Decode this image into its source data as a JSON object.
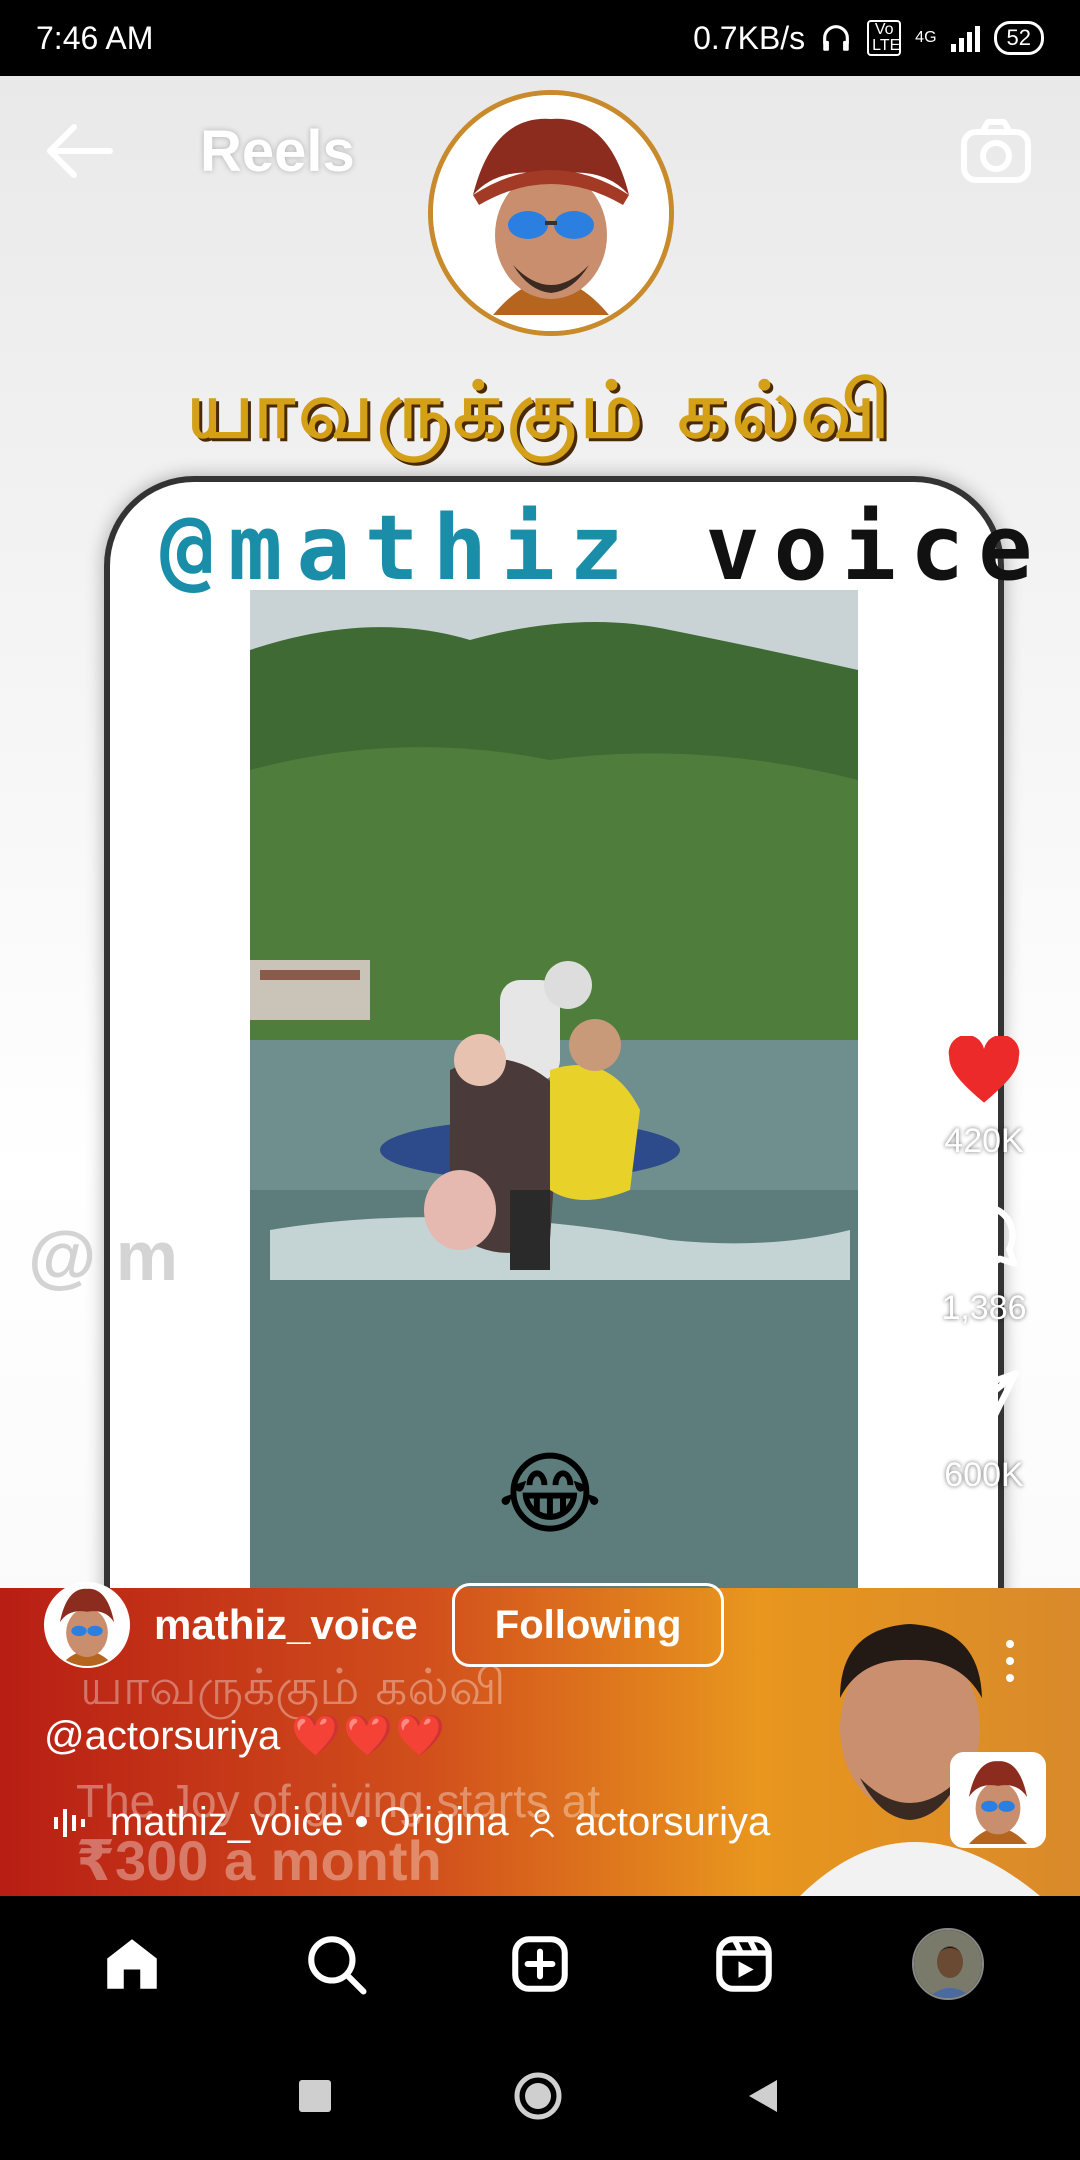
{
  "status_bar": {
    "time": "7:46 AM",
    "net_speed": "0.7KB/s",
    "volte": "Vo LTE",
    "network": "4G",
    "battery": "52"
  },
  "header": {
    "title": "Reels"
  },
  "video": {
    "tamil_heading": "யாவருக்கும் கல்வி",
    "handle_at": "@mathiz",
    "handle_rest": "_voice",
    "emoji": "😂",
    "watermark": "@ m"
  },
  "actions": {
    "likes": "420K",
    "comments": "1,386",
    "shares": "600K",
    "like_color": "#ed2a2a"
  },
  "post": {
    "username": "mathiz_voice",
    "follow_label": "Following",
    "caption_mention": "@actorsuriya",
    "caption_hearts": "❤️❤️❤️",
    "audio_text": "mathiz_voice • Origina",
    "tagged_user": "actorsuriya",
    "ad_ghost_tamil": "யாவருக்கும் கல்வி",
    "ad_ghost_line": "The Joy of giving starts at",
    "ad_ghost_price": "₹300 a month"
  },
  "nav": {
    "items": [
      "home-icon",
      "search-icon",
      "create-icon",
      "reels-icon",
      "profile-avatar"
    ]
  }
}
